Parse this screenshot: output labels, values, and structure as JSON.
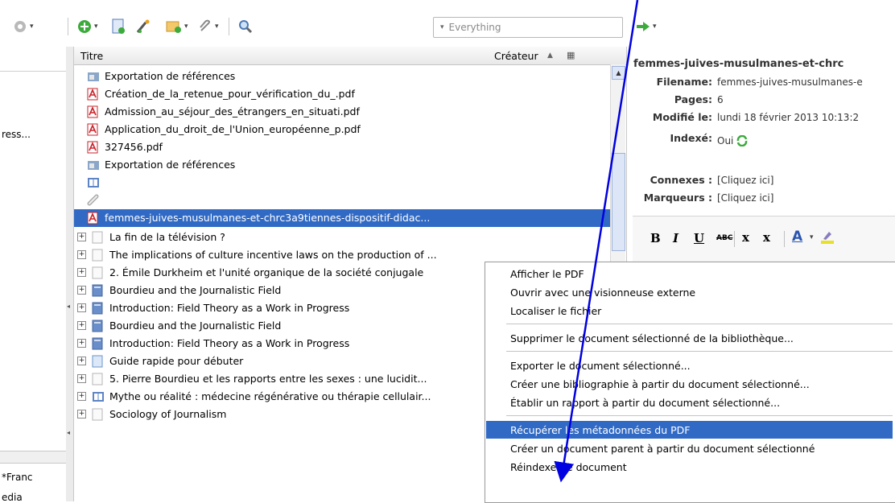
{
  "toolbar": {
    "search_placeholder": "Everything",
    "icons": [
      "gear-icon",
      "add-item-icon",
      "new-note-icon",
      "magic-wand-icon",
      "new-collection-icon",
      "attach-icon",
      "search-icon",
      "forward-arrow-icon"
    ]
  },
  "left_pane": {
    "items": [
      "ress...",
      "*Franc",
      "edia"
    ]
  },
  "list": {
    "columns": {
      "title": "Titre",
      "creator": "Créateur"
    },
    "rows": [
      {
        "text": "Exportation de références",
        "icon": "report-icon",
        "expander": false,
        "selected": false
      },
      {
        "text": "Création_de_la_retenue_pour_vérification_du_.pdf",
        "icon": "pdf-icon",
        "expander": false,
        "selected": false
      },
      {
        "text": "Admission_au_séjour_des_étrangers_en_situati.pdf",
        "icon": "pdf-icon",
        "expander": false,
        "selected": false
      },
      {
        "text": "Application_du_droit_de_l'Union_européenne_p.pdf",
        "icon": "pdf-icon",
        "expander": false,
        "selected": false
      },
      {
        "text": "327456.pdf",
        "icon": "pdf-icon",
        "expander": false,
        "selected": false
      },
      {
        "text": "Exportation de références",
        "icon": "report-icon",
        "expander": false,
        "selected": false
      },
      {
        "text": "",
        "icon": "book-icon",
        "expander": false,
        "selected": false
      },
      {
        "text": "",
        "icon": "link-icon",
        "expander": false,
        "selected": false
      },
      {
        "text": "femmes-juives-musulmanes-et-chrc3a9tiennes-dispositif-didac...",
        "icon": "pdf-icon",
        "expander": false,
        "selected": true
      },
      {
        "text": "La fin de la télévision ?",
        "icon": "document-icon",
        "expander": true,
        "selected": false
      },
      {
        "text": "The implications of culture incentive laws on the production of ...",
        "icon": "document-icon",
        "expander": true,
        "selected": false
      },
      {
        "text": "2.  Émile Durkheim et l'unité organique de la société conjugale",
        "icon": "document-icon",
        "expander": true,
        "selected": false
      },
      {
        "text": "Bourdieu and the Journalistic Field",
        "icon": "journal-article-icon",
        "expander": true,
        "selected": false
      },
      {
        "text": "Introduction: Field Theory as a Work in Progress",
        "icon": "journal-article-icon",
        "expander": true,
        "selected": false
      },
      {
        "text": "Bourdieu and the Journalistic Field",
        "icon": "journal-article-icon",
        "expander": true,
        "selected": false
      },
      {
        "text": "Introduction: Field Theory as a Work in Progress",
        "icon": "journal-article-icon",
        "expander": true,
        "selected": false
      },
      {
        "text": "Guide rapide pour débuter",
        "icon": "webpage-icon",
        "expander": true,
        "selected": false
      },
      {
        "text": "5. Pierre Bourdieu et les rapports entre les sexes : une lucidit...",
        "icon": "document-icon",
        "expander": true,
        "selected": false
      },
      {
        "text": "Mythe ou réalité : médecine régénérative ou thérapie cellulair...",
        "icon": "book-icon",
        "expander": true,
        "selected": false
      },
      {
        "text": "Sociology of Journalism",
        "icon": "document-icon",
        "expander": true,
        "selected": false
      }
    ]
  },
  "info_pane": {
    "title": "femmes-juives-musulmanes-et-chrc",
    "filename_label": "Filename:",
    "filename_value": "femmes-juives-musulmanes-e",
    "pages_label": "Pages:",
    "pages_value": "6",
    "modified_label": "Modifié le:",
    "modified_value": "lundi 18 février 2013 10:13:2",
    "indexed_label": "Indexé:",
    "indexed_value": "Oui",
    "related_label": "Connexes :",
    "related_value": "[Cliquez ici]",
    "tags_label": "Marqueurs :",
    "tags_value": "[Cliquez ici]"
  },
  "editor_toolbar": {
    "bold": "B",
    "italic": "I",
    "underline": "U",
    "strike": "ABC",
    "subscript": "x",
    "superscript": "x",
    "font_color": "A"
  },
  "context_menu": {
    "groups": [
      [
        "Afficher le PDF",
        "Ouvrir avec une visionneuse externe",
        "Localiser le fichier"
      ],
      [
        "Supprimer le document sélectionné de la bibliothèque..."
      ],
      [
        "Exporter le document sélectionné...",
        "Créer une bibliographie à partir du document sélectionné...",
        "Établir un rapport à partir du document sélectionné..."
      ],
      [
        "Récupérer les métadonnées du PDF",
        "Créer un document parent à partir du document sélectionné",
        "Réindexer le document"
      ]
    ],
    "highlighted": "Récupérer les métadonnées du PDF"
  },
  "colors": {
    "selection": "#316ac5",
    "annotation_arrow": "#0000e0",
    "pdf_red": "#c8242b"
  }
}
